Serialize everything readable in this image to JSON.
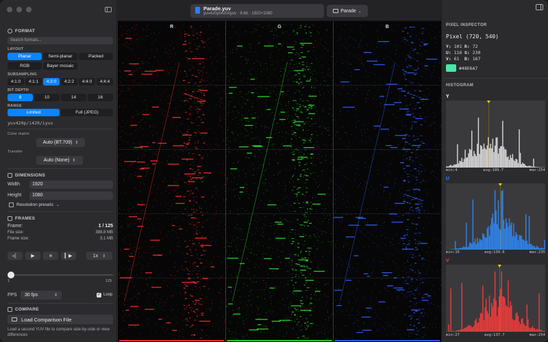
{
  "sidebar": {
    "format": {
      "title": "FORMAT",
      "search_placeholder": "Search formats...",
      "layout_label": "LAYOUT",
      "layout_options": [
        "Planar",
        "Semi-planar",
        "Packed",
        "RGB",
        "Bayer mosaic"
      ],
      "layout_selected": "Planar",
      "subsampling_label": "SUBSAMPLING",
      "subsampling_options": [
        "4:1:0",
        "4:1:1",
        "4:2:0",
        "4:2:2",
        "4:4:0",
        "4:4:4"
      ],
      "subsampling_selected": "4:2:0",
      "bitdepth_label": "BIT DEPTH",
      "bitdepth_options": [
        "8",
        "10",
        "14",
        "16"
      ],
      "bitdepth_selected": "8",
      "range_label": "RANGE",
      "range_options": [
        "Limited",
        "Full (JPEG)"
      ],
      "range_selected": "Limited",
      "fourcc": "yuv420p/i420/iyuv",
      "color_matrix_label": "Color matrix",
      "color_matrix_value": "Auto (BT.709)",
      "transfer_label": "Transfer",
      "transfer_value": "Auto (None)"
    },
    "dimensions": {
      "title": "DIMENSIONS",
      "width_label": "Width",
      "width_value": "1920",
      "height_label": "Height",
      "height_value": "1080",
      "presets_label": "Resolution presets"
    },
    "frames": {
      "title": "FRAMES",
      "frame_label": "Frame:",
      "frame_value": "1 / 125",
      "filesize_label": "File size:",
      "filesize_value": "388.8 MB",
      "framesize_label": "Frame size:",
      "framesize_value": "3.1 MB",
      "speed": "1x",
      "slider_min": "1",
      "slider_max": "125",
      "fps_label": "FPS",
      "fps_value": "30 fps",
      "loop_label": "Loop",
      "loop_checked": true
    },
    "compare": {
      "title": "COMPARE",
      "button_label": "Load Comparison File",
      "help": "Load a second YUV file to compare side-by-side or view differences"
    }
  },
  "titlebar": {
    "filename": "Parade.yuv",
    "subtitle": "yuv420p/i420/iyuv · 8-bit · 1920×1080",
    "view_mode": "Parade"
  },
  "parade": {
    "channels": [
      "R",
      "G",
      "B"
    ],
    "colors": [
      "#ff3030",
      "#30e030",
      "#3060ff"
    ]
  },
  "inspector": {
    "pixel_title": "PIXEL INSPECTOR",
    "pixel_heading": "Pixel (720, 540)",
    "values": [
      {
        "k": "Y:",
        "v": "101"
      },
      {
        "k": "R:",
        "v": "72"
      },
      {
        "k": "U:",
        "v": "116"
      },
      {
        "k": "G:",
        "v": "230"
      },
      {
        "k": "V:",
        "v": "61"
      },
      {
        "k": "B:",
        "v": "167"
      }
    ],
    "hex": "#48E6A7",
    "histogram_title": "HISTOGRAM",
    "histograms": [
      {
        "channel": "Y",
        "color": "#e8e8e8",
        "label_color": "#ffffff",
        "min": "min:4",
        "avg": "avg:109.7",
        "max": "max:254",
        "avg_value": 109.7
      },
      {
        "channel": "U",
        "color": "#2f8cff",
        "label_color": "#2f8cff",
        "min": "min:16",
        "avg": "avg:139.6",
        "max": "max:235",
        "avg_value": 139.6
      },
      {
        "channel": "V",
        "color": "#ff3b3b",
        "label_color": "#ff3b3b",
        "min": "min:27",
        "avg": "avg:137.7",
        "max": "max:254",
        "avg_value": 137.7
      }
    ]
  }
}
